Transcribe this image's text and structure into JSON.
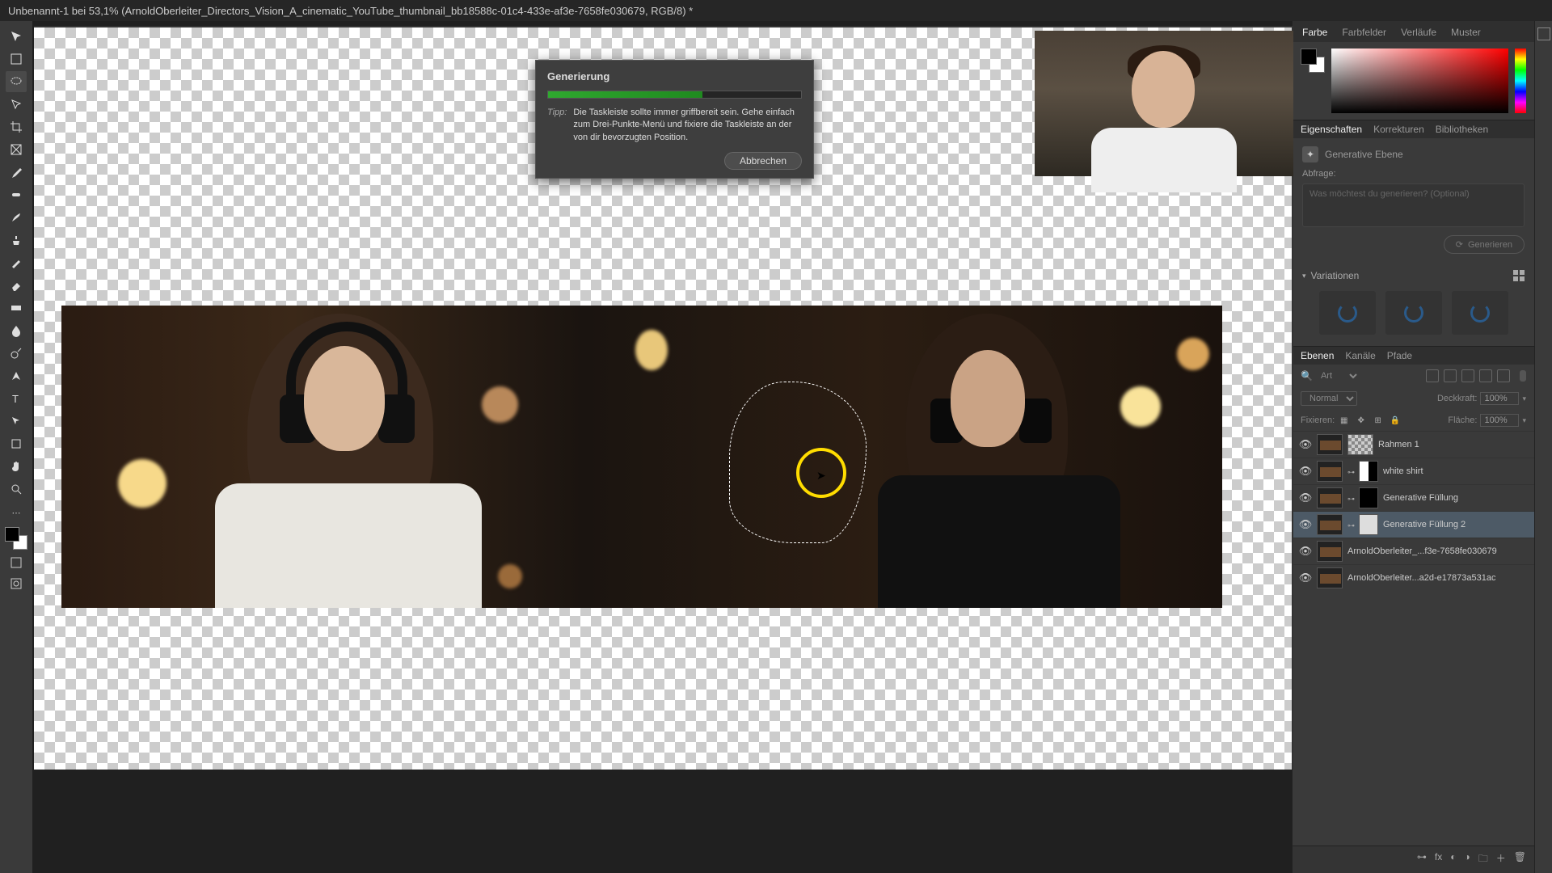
{
  "title_bar": "Unbenannt-1 bei 53,1% (ArnoldOberleiter_Directors_Vision_A_cinematic_YouTube_thumbnail_bb18588c-01c4-433e-af3e-7658fe030679, RGB/8) *",
  "dialog": {
    "title": "Generierung",
    "progress_pct": 61,
    "tip_label": "Tipp:",
    "tip_text": "Die Taskleiste sollte immer griffbereit sein. Gehe einfach zum Drei-Punkte-Menü und fixiere die Taskleiste an der von dir bevorzugten Position.",
    "cancel": "Abbrechen"
  },
  "color_panel": {
    "tabs": [
      "Farbe",
      "Farbfelder",
      "Verläufe",
      "Muster"
    ],
    "active_tab": 0
  },
  "properties_panel": {
    "tabs": [
      "Eigenschaften",
      "Korrekturen",
      "Bibliotheken"
    ],
    "active_tab": 0,
    "layer_type": "Generative Ebene",
    "prompt_label": "Abfrage:",
    "prompt_placeholder": "Was möchtest du generieren? (Optional)",
    "generate_btn": "Generieren",
    "variations_label": "Variationen"
  },
  "layers_panel": {
    "tabs": [
      "Ebenen",
      "Kanäle",
      "Pfade"
    ],
    "active_tab": 0,
    "search_kind": "Art",
    "blend_mode": "Normal",
    "opacity_label": "Deckkraft:",
    "opacity_value": "100%",
    "lock_label": "Fixieren:",
    "fill_label": "Fläche:",
    "fill_value": "100%",
    "layers": [
      {
        "name": "Rahmen 1",
        "mask": "chk",
        "type": "frame"
      },
      {
        "name": "white shirt",
        "mask": "half",
        "type": "gen"
      },
      {
        "name": "Generative Füllung",
        "mask": "blk",
        "type": "gen"
      },
      {
        "name": "Generative Füllung 2",
        "mask": "white",
        "type": "gen",
        "selected": true
      },
      {
        "name": "ArnoldOberleiter_...f3e-7658fe030679",
        "mask": null,
        "type": "img"
      },
      {
        "name": "ArnoldOberleiter...a2d-e17873a531ac",
        "mask": null,
        "type": "img"
      }
    ]
  },
  "tool_names": [
    "move",
    "artboard",
    "lasso",
    "polygon-lasso",
    "magic-wand",
    "crop",
    "eyedropper",
    "spot-heal",
    "brush",
    "clone",
    "history-brush",
    "eraser",
    "gradient",
    "blur",
    "dodge",
    "pen",
    "type",
    "path-select",
    "rectangle",
    "hand",
    "zoom"
  ]
}
